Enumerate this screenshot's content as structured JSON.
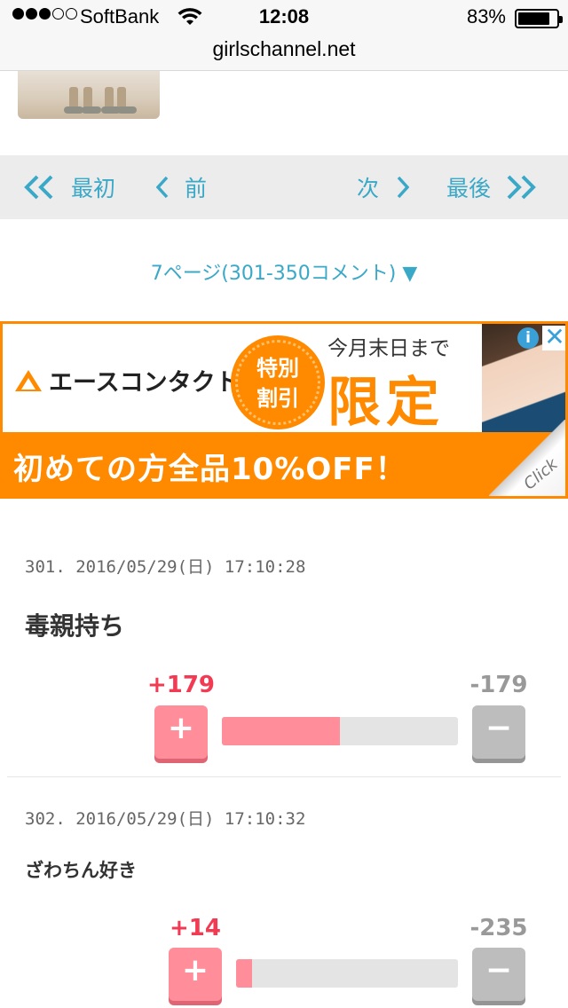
{
  "status_bar": {
    "carrier": "SoftBank",
    "time": "12:08",
    "battery": "83%",
    "url": "girlschannel.net"
  },
  "pager": {
    "first": "最初",
    "prev": "前",
    "next": "次",
    "last": "最後",
    "page_info": "7ページ(301-350コメント) ▼",
    "accent": "#3aa8c7"
  },
  "ad": {
    "brand": "エースコンタクト",
    "badge_line1": "特別",
    "badge_line2": "割引",
    "sub": "今月末日まで",
    "main": "限定",
    "bottom": "初めての方全品10%OFF！",
    "click": "Click",
    "accent": "#ff8a00"
  },
  "comments": [
    {
      "meta": "301. 2016/05/29(日) 17:10:28",
      "text": "毒親持ち",
      "plus": "+179",
      "minus": "-179",
      "plus_ratio": 0.5
    },
    {
      "meta": "302. 2016/05/29(日) 17:10:32",
      "text": "ざわちん好き",
      "plus": "+14",
      "minus": "-235",
      "plus_ratio": 0.07
    }
  ]
}
